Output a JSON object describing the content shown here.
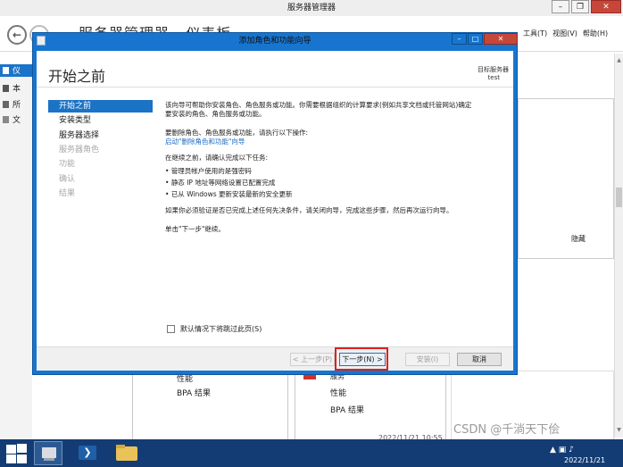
{
  "outer_window": {
    "title": "服务器管理器",
    "window_buttons": [
      "–",
      "❐",
      "✕"
    ],
    "breadcrumb": "服务器管理器 · 仪表板",
    "menus": [
      "工具(T)",
      "视图(V)",
      "帮助(H)"
    ],
    "sidebar_items": [
      "仪",
      "本",
      "所",
      "文"
    ],
    "hide_label": "隐藏",
    "tiles": {
      "left_lines": [
        "性能",
        "BPA 结果"
      ],
      "right_header": "服务",
      "right_lines": [
        "性能",
        "BPA 结果"
      ],
      "timestamp": "2022/11/21 10:55"
    }
  },
  "dialog": {
    "title": "添加角色和功能向导",
    "buttons": [
      "–",
      "□",
      "✕"
    ],
    "heading": "开始之前",
    "target_server_label": "目标服务器",
    "target_server_value": "test",
    "steps": [
      {
        "label": "开始之前",
        "state": "active"
      },
      {
        "label": "安装类型",
        "state": "normal"
      },
      {
        "label": "服务器选择",
        "state": "normal"
      },
      {
        "label": "服务器角色",
        "state": "disabled"
      },
      {
        "label": "功能",
        "state": "disabled"
      },
      {
        "label": "确认",
        "state": "disabled"
      },
      {
        "label": "结果",
        "state": "disabled"
      }
    ],
    "content": {
      "p1_line1": "该向导可帮助你安装角色、角色服务或功能。你需要根据组织的计算要求(例如共享文档或托管网站)确定",
      "p1_line2": "要安装的角色、角色服务或功能。",
      "p2_line1": "要删除角色、角色服务或功能，请执行以下操作:",
      "p2_link": "启动\"删除角色和功能\"向导",
      "p3": "在继续之前，请确认完成以下任务:",
      "bullets": [
        "管理员帐户使用的是强密码",
        "静态 IP 地址等网络设置已配置完成",
        "已从 Windows 更新安装最新的安全更新"
      ],
      "p4": "如果你必须验证是否已完成上述任何先决条件，请关闭向导，完成这些步骤，然后再次运行向导。",
      "p5": "单击\"下一步\"继续。"
    },
    "skip_checkbox_label": "默认情况下将跳过此页(S)",
    "footer_buttons": {
      "prev": "< 上一步(P)",
      "next": "下一步(N) >",
      "install": "安装(I)",
      "cancel": "取消"
    }
  },
  "taskbar": {
    "date": "2022/11/21",
    "watermark": "CSDN @千淌天下侩"
  },
  "colors": {
    "dialog_frame": "#1875cf",
    "active_step": "#1b73c5",
    "link": "#1a6bc1",
    "highlight": "#e0201a",
    "taskbar": "#143c74"
  }
}
